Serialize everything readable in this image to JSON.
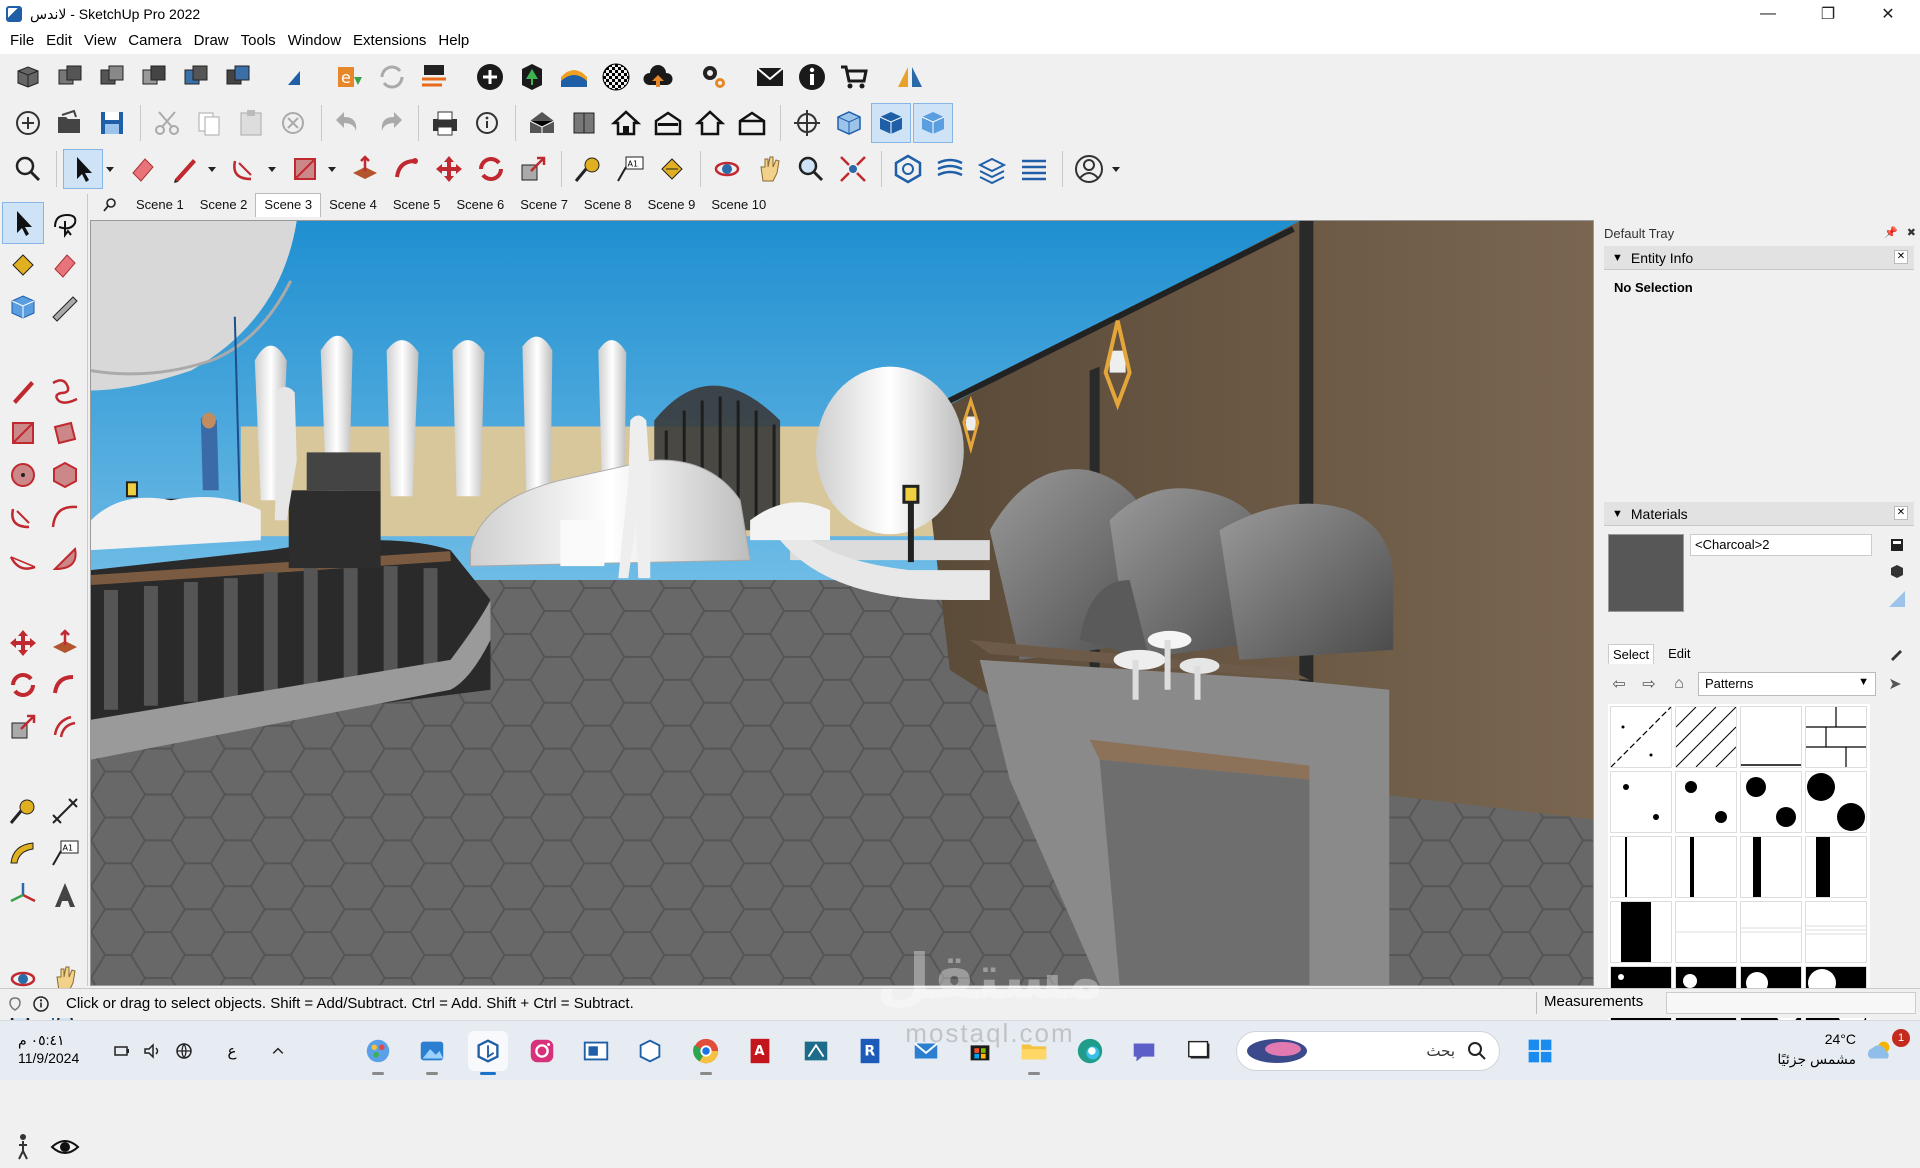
{
  "window": {
    "title": "لاندس - SketchUp Pro 2022",
    "minimize_glyph": "—",
    "maximize_glyph": "❐",
    "close_glyph": "✕"
  },
  "menu": [
    "File",
    "Edit",
    "View",
    "Camera",
    "Draw",
    "Tools",
    "Window",
    "Extensions",
    "Help"
  ],
  "scenes": {
    "items": [
      "Scene 1",
      "Scene 2",
      "Scene 3",
      "Scene 4",
      "Scene 5",
      "Scene 6",
      "Scene 7",
      "Scene 8",
      "Scene 9",
      "Scene 10"
    ],
    "active": "Scene 3"
  },
  "tray": {
    "title": "Default Tray",
    "entity_info": {
      "header": "Entity Info",
      "status": "No Selection"
    },
    "materials": {
      "header": "Materials",
      "current_name": "<Charcoal>2",
      "swatch_color": "#575757",
      "tabs": [
        "Select",
        "Edit"
      ],
      "library": "Patterns"
    }
  },
  "status": {
    "hint": "Click or drag to select objects. Shift = Add/Subtract. Ctrl = Add. Shift + Ctrl = Subtract.",
    "measurements_label": "Measurements",
    "measurements_value": ""
  },
  "taskbar": {
    "time": "٠٥:٤١ م",
    "date": "11/9/2024",
    "language": "ع",
    "search_placeholder": "بحث",
    "weather_temp": "24°C",
    "weather_desc": "مشمس جزئيًا",
    "notification_count": "1"
  },
  "watermark": {
    "arabic": "مستقل",
    "latin": "mostaql.com"
  },
  "colors": {
    "sky": "#3ba3db",
    "ground": "#6a6a6a",
    "accent": "#1a73c8"
  },
  "icons": {
    "toolbar1": [
      "components-icon",
      "solid-tools-icon",
      "send-to-layout-icon",
      "extension-warehouse-icon",
      "trimble-icon",
      "add-location-icon",
      "info-icon",
      "cart-icon"
    ],
    "toolbar2": [
      "new-icon",
      "open-icon",
      "save-icon",
      "cut-icon",
      "copy-icon",
      "paste-icon",
      "erase-icon",
      "undo-icon",
      "redo-icon",
      "print-icon",
      "model-info-icon",
      "iso-view-icon",
      "top-view-icon",
      "front-view-icon",
      "right-view-icon",
      "back-view-icon",
      "left-view-icon"
    ],
    "toolbar3": [
      "zoom-icon",
      "select-icon",
      "eraser-icon",
      "pencil-icon",
      "arc-icon",
      "rectangle-icon",
      "push-pull-icon",
      "follow-me-icon",
      "move-icon",
      "rotate-icon",
      "scale-icon",
      "tape-measure-icon",
      "text-icon",
      "paint-bucket-icon",
      "orbit-icon",
      "pan-icon",
      "zoom-tool-icon",
      "zoom-extents-icon",
      "sandbox-icon",
      "user-icon"
    ]
  }
}
